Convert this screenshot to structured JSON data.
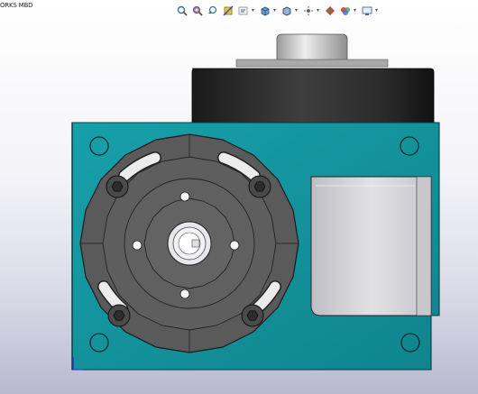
{
  "tab": {
    "label": "ORKS MBD"
  },
  "toolbar": {
    "items": [
      {
        "name": "zoom-to-fit-icon"
      },
      {
        "name": "zoom-area-icon"
      },
      {
        "name": "previous-view-icon"
      },
      {
        "name": "section-view-icon"
      },
      {
        "name": "dynamic-annotation-icon"
      },
      {
        "name": "view-orientation-icon"
      },
      {
        "name": "display-style-icon"
      },
      {
        "name": "hide-show-items-icon"
      },
      {
        "name": "edit-appearance-icon"
      },
      {
        "name": "apply-scene-icon"
      },
      {
        "name": "view-settings-icon"
      }
    ]
  },
  "colors": {
    "housing": "#13909a",
    "housing_dark": "#0c6d75",
    "dial": "#5c5c5c",
    "motor_body": "#2a2a2a",
    "shaft": "#c8c8c8",
    "cover": "#d7d7db",
    "triad_x": "#2233cc"
  }
}
